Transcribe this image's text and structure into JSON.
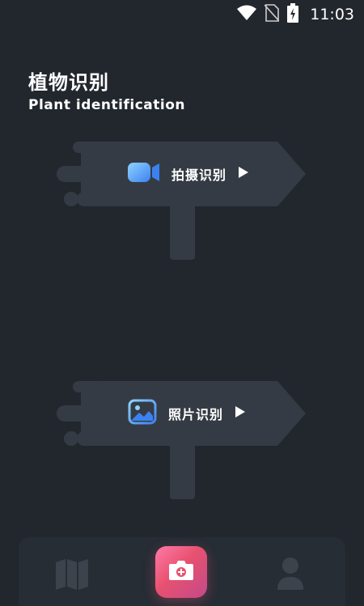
{
  "status_bar": {
    "time": "11:03",
    "icons": [
      "wifi-icon",
      "no-sim-icon",
      "battery-charging-icon"
    ]
  },
  "header": {
    "title": "植物识别",
    "subtitle": "Plant identification"
  },
  "actions": [
    {
      "label": "拍摄识别",
      "icon": "video-camera-icon"
    },
    {
      "label": "照片识别",
      "icon": "photo-gallery-icon"
    }
  ],
  "bottom_nav": {
    "items": [
      "map-icon",
      "camera-icon",
      "user-icon"
    ]
  },
  "colors": {
    "background": "#22272e",
    "sign": "#353b44",
    "accent_blue": "#4a9df0",
    "accent_pink": "#e8516f"
  }
}
